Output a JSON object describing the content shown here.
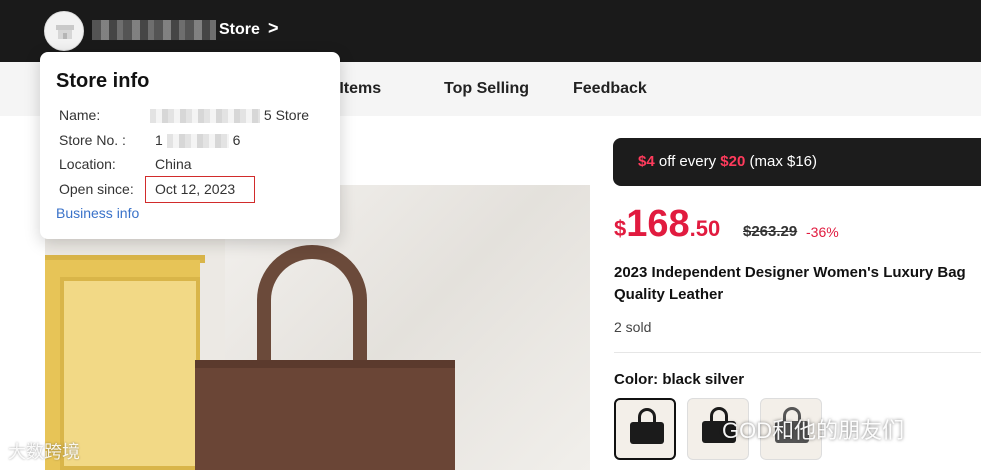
{
  "header": {
    "store_label": "Store",
    "chevron": ">"
  },
  "nav": {
    "items": [
      "e Items",
      "Top Selling",
      "Feedback"
    ]
  },
  "store_info": {
    "title": "Store info",
    "rows": [
      {
        "label": "Name:",
        "value": "5 Store"
      },
      {
        "label": "Store No. :",
        "value_prefix": "1",
        "value": "6"
      },
      {
        "label": "Location:",
        "value": "China"
      },
      {
        "label": "Open since:",
        "value": "Oct 12, 2023"
      }
    ],
    "business_link": "Business info",
    "highlight_color": "#d12b2b"
  },
  "promo": {
    "amount": "$4",
    "middle": " off every ",
    "threshold": "$20",
    "suffix": " (max $16)"
  },
  "price": {
    "currency": "$",
    "integer": "168",
    "decimal": ".50",
    "original": "$263.29",
    "discount": "-36%",
    "color": "#e11b3f"
  },
  "product": {
    "title_line1": "2023 Independent Designer Women's Luxury Bag",
    "title_line2": "Quality Leather",
    "sold": "2 sold",
    "color_label": "Color: black silver",
    "swatches": [
      "black silver",
      "black",
      "black"
    ]
  },
  "watermarks": {
    "left": "大数跨境",
    "right": "GOD和他的朋友们"
  }
}
